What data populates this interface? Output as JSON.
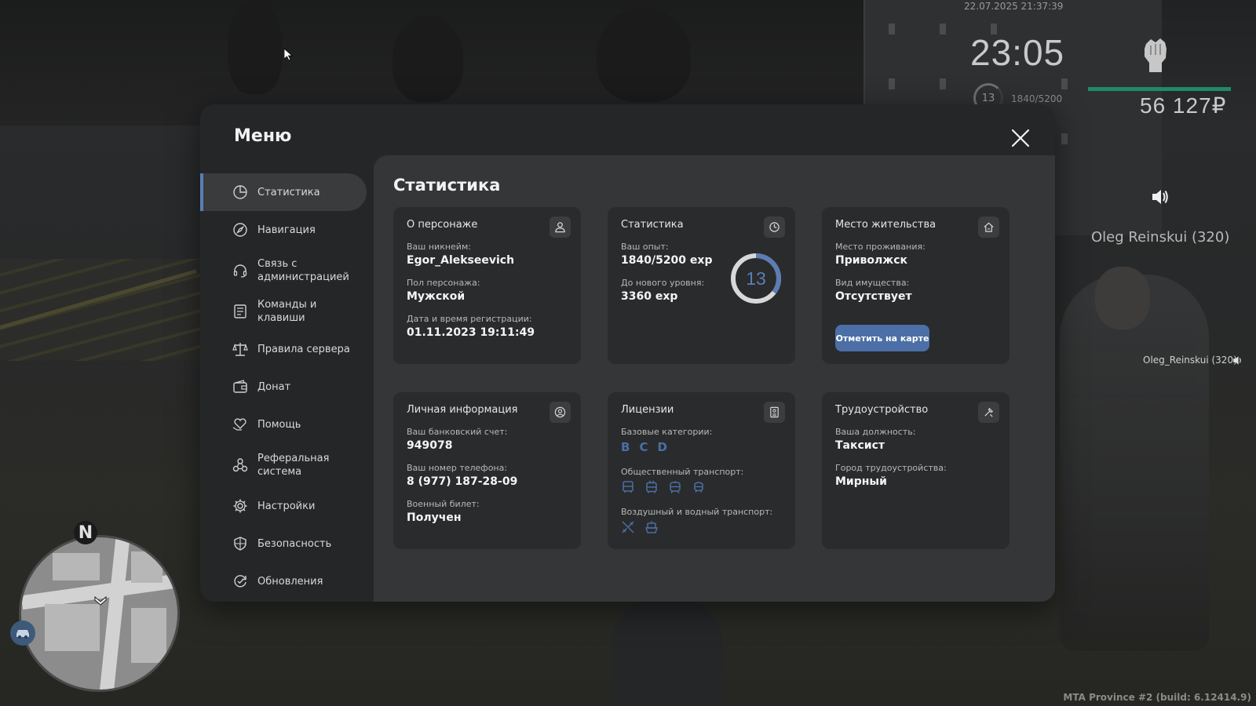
{
  "hud": {
    "datetime": "22.07.2025 21:37:39",
    "clock": "23:05",
    "money": "56 127₽",
    "level": "13",
    "exp": "1840/5200",
    "player_name": "Oleg Reinskui (320)",
    "chat_name": "Oleg_Reinskui (320)",
    "build": "MTA Province #2 (build: 6.12414.9)",
    "compass": "N",
    "health_color": "#1f8a6a"
  },
  "menu": {
    "title": "Меню",
    "close_icon": "close-icon"
  },
  "sidebar": {
    "items": [
      {
        "label": "Статистика",
        "icon": "pie-chart-icon",
        "active": true
      },
      {
        "label": "Навигация",
        "icon": "compass-icon"
      },
      {
        "label": "Связь с\nадминистрацией",
        "icon": "headset-icon"
      },
      {
        "label": "Команды и клавиши",
        "icon": "list-icon"
      },
      {
        "label": "Правила сервера",
        "icon": "scales-icon"
      },
      {
        "label": "Донат",
        "icon": "wallet-icon"
      },
      {
        "label": "Помощь",
        "icon": "heart-hands-icon"
      },
      {
        "label": "Реферальная\nсистема",
        "icon": "referral-icon"
      },
      {
        "label": "Настройки",
        "icon": "gear-icon"
      },
      {
        "label": "Безопасность",
        "icon": "shield-icon"
      },
      {
        "label": "Обновления",
        "icon": "refresh-icon"
      }
    ]
  },
  "content": {
    "title": "Статистика",
    "character": {
      "title": "О персонаже",
      "nickname_label": "Ваш никнейм:",
      "nickname": "Egor_Alekseevich",
      "gender_label": "Пол персонажа:",
      "gender": "Мужской",
      "reg_label": "Дата и время регистрации:",
      "reg": "01.11.2023 19:11:49"
    },
    "stats": {
      "title": "Статистика",
      "exp_label": "Ваш опыт:",
      "exp": "1840/5200 exp",
      "next_label": "До нового уровня:",
      "next": "3360 exp",
      "level": "13",
      "progress": 0.354
    },
    "residence": {
      "title": "Место жительства",
      "place_label": "Место проживания:",
      "place": "Приволжск",
      "property_label": "Вид имущества:",
      "property": "Отсутствует",
      "button": "Отметить на карте"
    },
    "personal": {
      "title": "Личная информация",
      "bank_label": "Ваш банковский счет:",
      "bank": "949078",
      "phone_label": "Ваш номер телефона:",
      "phone": "8 (977) 187-28-09",
      "military_label": "Военный билет:",
      "military": "Получен"
    },
    "licenses": {
      "title": "Лицензии",
      "basic_label": "Базовые категории:",
      "categories": [
        "B",
        "C",
        "D"
      ],
      "public_label": "Общественный транспорт:",
      "air_label": "Воздушный и водный транспорт:"
    },
    "job": {
      "title": "Трудоустройство",
      "position_label": "Ваша должность:",
      "position": "Таксист",
      "city_label": "Город трудоустройства:",
      "city": "Мирный"
    }
  },
  "colors": {
    "accent": "#4b6fa6",
    "ring_track": "#d8d8d8",
    "ring_fill": "#5a7db5"
  }
}
